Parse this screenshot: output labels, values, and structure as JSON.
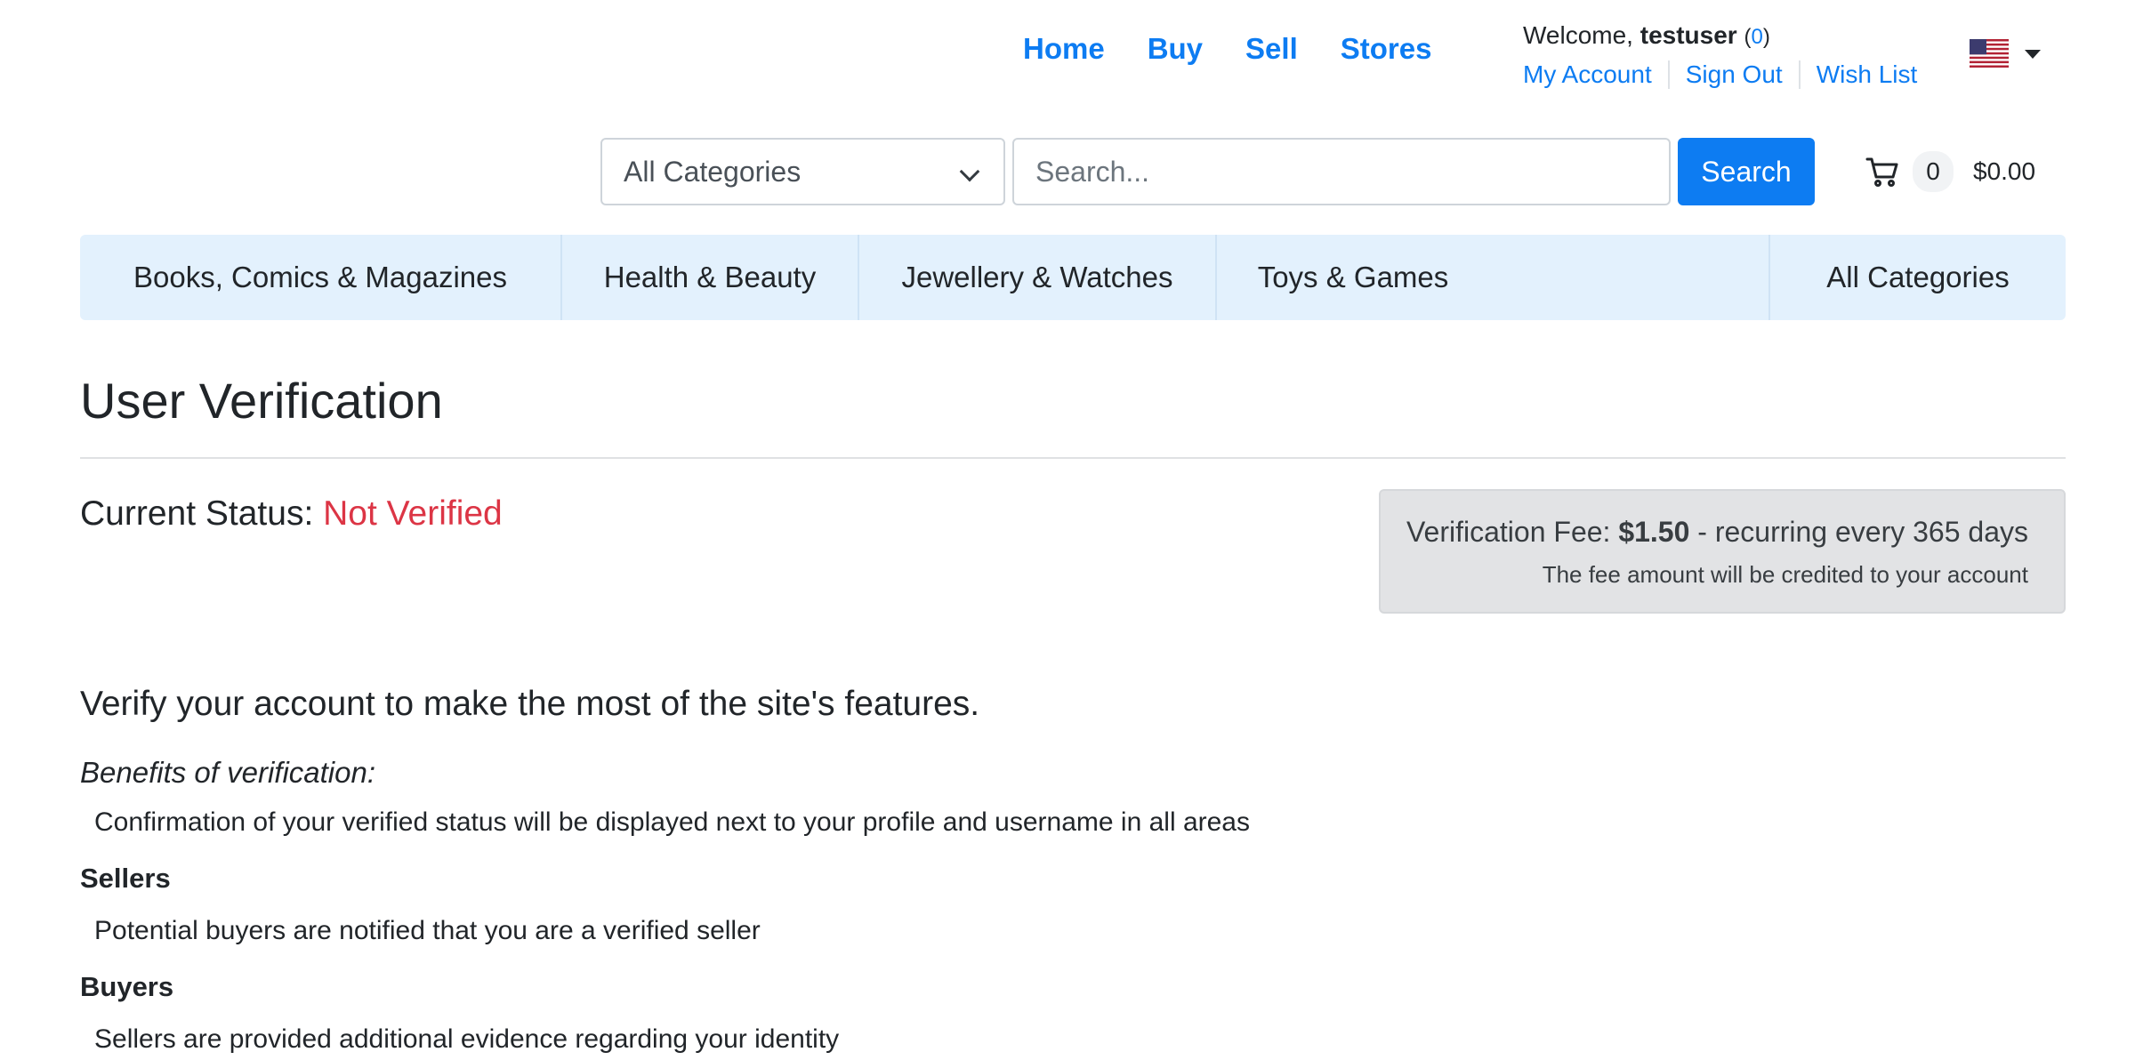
{
  "nav": {
    "home": "Home",
    "buy": "Buy",
    "sell": "Sell",
    "stores": "Stores"
  },
  "user": {
    "welcome_prefix": "Welcome,",
    "username": "testuser",
    "message_count": "0",
    "my_account": "My Account",
    "sign_out": "Sign Out",
    "wish_list": "Wish List"
  },
  "search": {
    "category_selected": "All Categories",
    "placeholder": "Search...",
    "button": "Search"
  },
  "cart": {
    "count": "0",
    "total": "$0.00"
  },
  "categories": [
    "Books, Comics & Magazines",
    "Health & Beauty",
    "Jewellery & Watches",
    "Toys & Games",
    "All Categories"
  ],
  "page": {
    "title": "User Verification",
    "status_label": "Current Status:",
    "status_value": "Not Verified",
    "fee_label": "Verification Fee:",
    "fee_amount": "$1.50",
    "fee_recurring": "- recurring every 365 days",
    "fee_note": "The fee amount will be credited to your account",
    "lead": "Verify your account to make the most of the site's features.",
    "benefits_heading": "Benefits of verification:",
    "benefit_general": "Confirmation of your verified status will be displayed next to your profile and username in all areas",
    "sellers_heading": "Sellers",
    "sellers_benefit": "Potential buyers are notified that you are a verified seller",
    "buyers_heading": "Buyers",
    "buyers_benefit": "Sellers are provided additional evidence regarding your identity"
  },
  "colors": {
    "link": "#0d7cf2",
    "danger": "#dc3545",
    "category_bar": "#e3f1fd",
    "fee_box": "#e2e3e5"
  }
}
